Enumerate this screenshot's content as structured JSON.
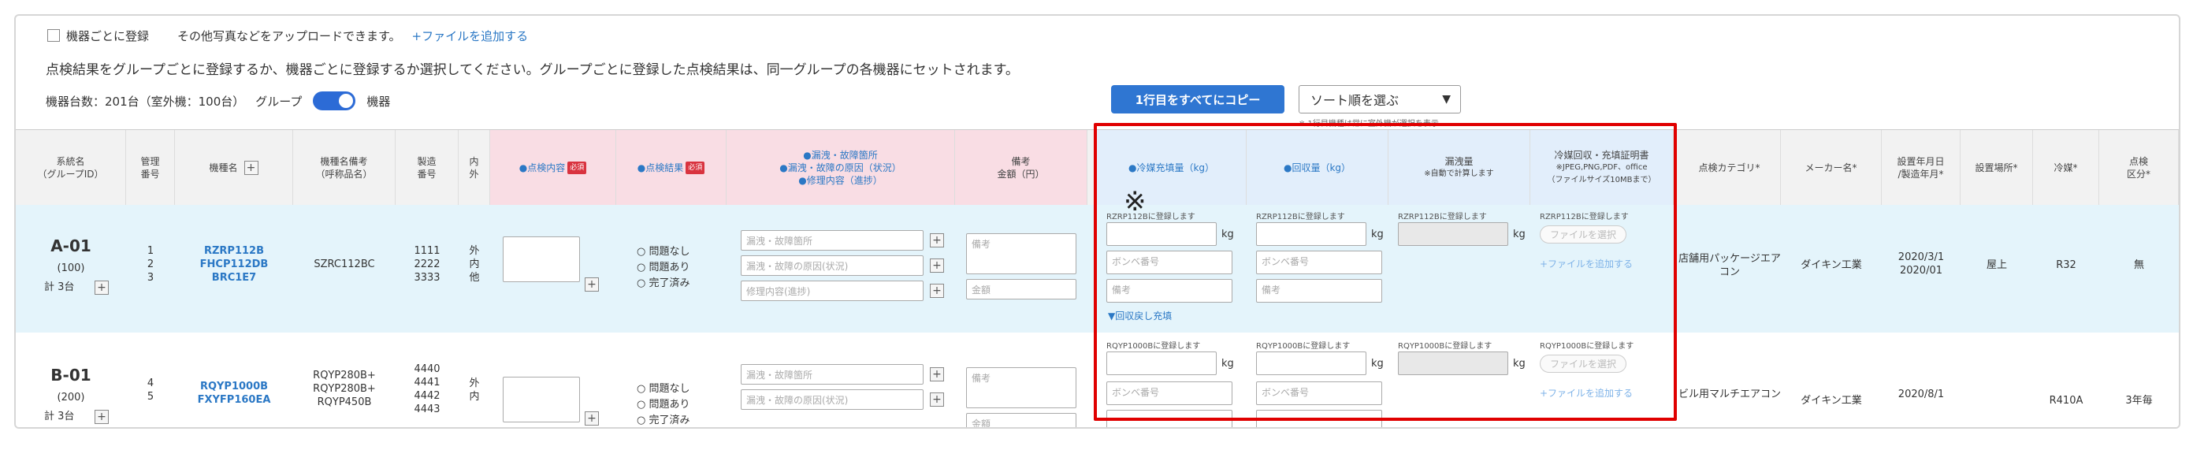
{
  "top": {
    "checkbox_label": "機器ごとに登録",
    "upload_text": "その他写真などをアップロードできます。",
    "add_file_link": "+ファイルを追加する"
  },
  "description": "点検結果をグループごとに登録するか、機器ごとに登録するか選択してください。グループごとに登録した点検結果は、同一グループの各機器にセットされます。",
  "count": {
    "label": "機器台数：201台（室外機：100台）",
    "group_label": "グループ",
    "device_label": "機器"
  },
  "toolbar": {
    "copy_button": "1行目をすべてにコピー",
    "sort_select": "ソート順を選ぶ",
    "sort_hint": "※ 1行目機種は常に室外機が選択を表示"
  },
  "headers": {
    "system_name": "系統名",
    "system_sub": "（グループID）",
    "mgmt_no": "管理",
    "mgmt_no2": "番号",
    "model": "機種名",
    "model_note": "機種名備考",
    "model_note2": "（呼称品名）",
    "serial": "製造",
    "serial2": "番号",
    "inout": "内",
    "inout2": "外",
    "inspect_content": "●点検内容",
    "inspect_result": "●点検結果",
    "required": "必須",
    "leak1": "●漏洩・故障箇所",
    "leak2": "●漏洩・故障の原因（状況）",
    "leak3": "●修理内容（進捗）",
    "remarks": "備考",
    "amount": "金額（円）",
    "charge": "●冷媒充填量（kg）",
    "recover": "●回収量（kg）",
    "leak_amount": "漏洩量",
    "leak_amount_sub": "※自動で計算します",
    "proof": "冷媒回収・充填証明書",
    "proof_sub1": "※JPEG,PNG,PDF、office",
    "proof_sub2": "（ファイルサイズ10MBまで）",
    "category": "点検カテゴリ*",
    "maker": "メーカー名*",
    "install_date": "設置年月日",
    "install_date2": "/製造年月*",
    "location": "設置場所*",
    "refrigerant": "冷媒*",
    "inspection_class": "点検",
    "inspection_class2": "区分*"
  },
  "rows": [
    {
      "system": "A-01",
      "group_id": "(100)",
      "total": "計 3台",
      "mgmt": [
        "1",
        "2",
        "3"
      ],
      "models": [
        "RZRP112B",
        "FHCP112DB",
        "BRC1E7"
      ],
      "model_note": "SZRC112BC",
      "serials": [
        "1111",
        "2222",
        "3333"
      ],
      "inout": [
        "外",
        "内",
        "他"
      ],
      "radio": [
        "問題なし",
        "問題あり",
        "完了済み"
      ],
      "leak_ph": [
        "漏洩・故障箇所",
        "漏洩・故障の原因(状況)",
        "修理内容(進捗)"
      ],
      "remarks_ph": "備考",
      "amount_ph": "金額",
      "reg_note": "RZRP112Bに登録します",
      "kg": "kg",
      "cylinder_ph": "ボンベ番号",
      "remarks2_ph": "備考",
      "recover_link": "▼回収戻し充填",
      "select_file": "ファイルを選択",
      "add_file": "+ファイルを追加する",
      "category": "店舗用パッケージエアコン",
      "maker": "ダイキン工業",
      "install_date": "2020/3/1",
      "manufacture_date": "2020/01",
      "location": "屋上",
      "refrigerant": "R32",
      "inspection_class": "無"
    },
    {
      "system": "B-01",
      "group_id": "(200)",
      "total": "計 3台",
      "mgmt": [
        "4",
        "5"
      ],
      "models": [
        "RQYP1000B",
        "FXYFP160EA"
      ],
      "model_note": [
        "RQYP280B+",
        "RQYP280B+",
        "RQYP450B"
      ],
      "serials": [
        "4440",
        "4441",
        "4442",
        "4443"
      ],
      "inout": [
        "外",
        "内"
      ],
      "radio": [
        "問題なし",
        "問題あり",
        "完了済み"
      ],
      "leak_ph": [
        "漏洩・故障箇所",
        "漏洩・故障の原因(状況)"
      ],
      "remarks_ph": "備考",
      "amount_ph": "金額",
      "reg_note": "RQYP1000Bに登録します",
      "kg": "kg",
      "cylinder_ph": "ボンベ番号",
      "select_file": "ファイルを選択",
      "add_file": "+ファイルを追加する",
      "category": "ビル用マルチエアコン",
      "maker": "ダイキン工業",
      "install_date": "2020/8/1",
      "refrigerant": "R410A",
      "inspection_class": "3年毎"
    }
  ],
  "annotation_mark": "※"
}
